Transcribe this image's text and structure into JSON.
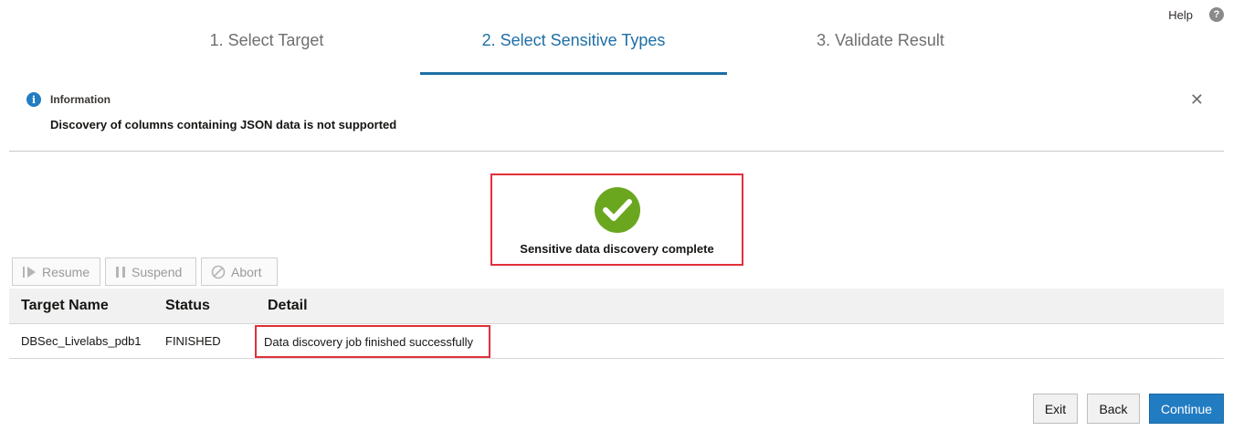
{
  "header": {
    "help_label": "Help",
    "help_icon": "question-circle-icon"
  },
  "train": {
    "steps": [
      {
        "label": "1. Select Target",
        "active": false
      },
      {
        "label": "2. Select Sensitive Types",
        "active": true
      },
      {
        "label": "3. Validate Result",
        "active": false
      }
    ]
  },
  "info": {
    "title": "Information",
    "message": "Discovery of columns containing JSON data is not supported",
    "close_icon": "close-icon"
  },
  "status": {
    "icon": "checkmark-circle-icon",
    "text": "Sensitive data discovery complete"
  },
  "toolbar": {
    "resume_label": "Resume",
    "suspend_label": "Suspend",
    "abort_label": "Abort"
  },
  "table": {
    "columns": [
      "Target Name",
      "Status",
      "Detail"
    ],
    "rows": [
      {
        "target": "DBSec_Livelabs_pdb1",
        "status": "FINISHED",
        "detail": "Data discovery job finished successfully"
      }
    ]
  },
  "footer": {
    "exit_label": "Exit",
    "back_label": "Back",
    "continue_label": "Continue"
  },
  "colors": {
    "accent": "#227cc2",
    "success": "#6aa71f",
    "highlight": "#e0313a"
  }
}
